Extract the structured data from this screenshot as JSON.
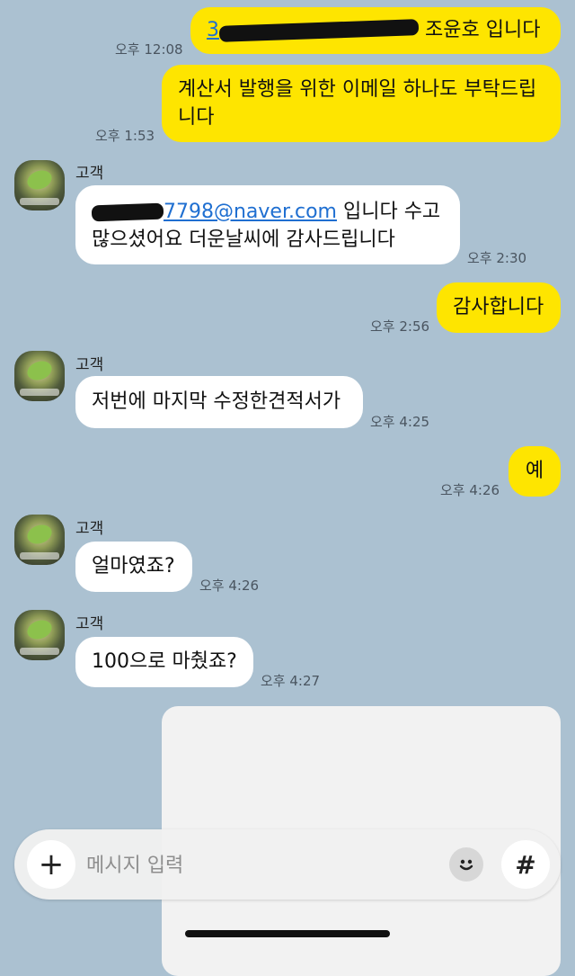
{
  "messages": {
    "m1": {
      "text": "조윤호 입니다",
      "time": "오후 12:08"
    },
    "m2": {
      "text": "계산서 발행을 위한 이메일 하나도 부탁드립니다",
      "time": "오후 1:53"
    },
    "m3": {
      "sender": "고객",
      "email": "7798@naver.com",
      "text": " 입니다 수고 많으셨어요 더운날씨에 감사드립니다",
      "time": "오후 2:30"
    },
    "m4": {
      "text": "감사합니다",
      "time": "오후 2:56"
    },
    "m5": {
      "sender": "고객",
      "text": "저번에 마지막 수정한견적서가",
      "time": "오후 4:25"
    },
    "m6": {
      "text": "예",
      "time": "오후 4:26"
    },
    "m7": {
      "sender": "고객",
      "text": "얼마였죠?",
      "time": "오후 4:26"
    },
    "m8": {
      "sender": "고객",
      "text": "100으로 마췄죠?",
      "time": "오후 4:27"
    }
  },
  "input": {
    "placeholder": "메시지 입력",
    "plus_label": "+",
    "hash_label": "#"
  },
  "colors": {
    "background": "#abc1d1",
    "my_bubble": "#fee500",
    "their_bubble": "#ffffff",
    "link": "#1f6fd1"
  }
}
